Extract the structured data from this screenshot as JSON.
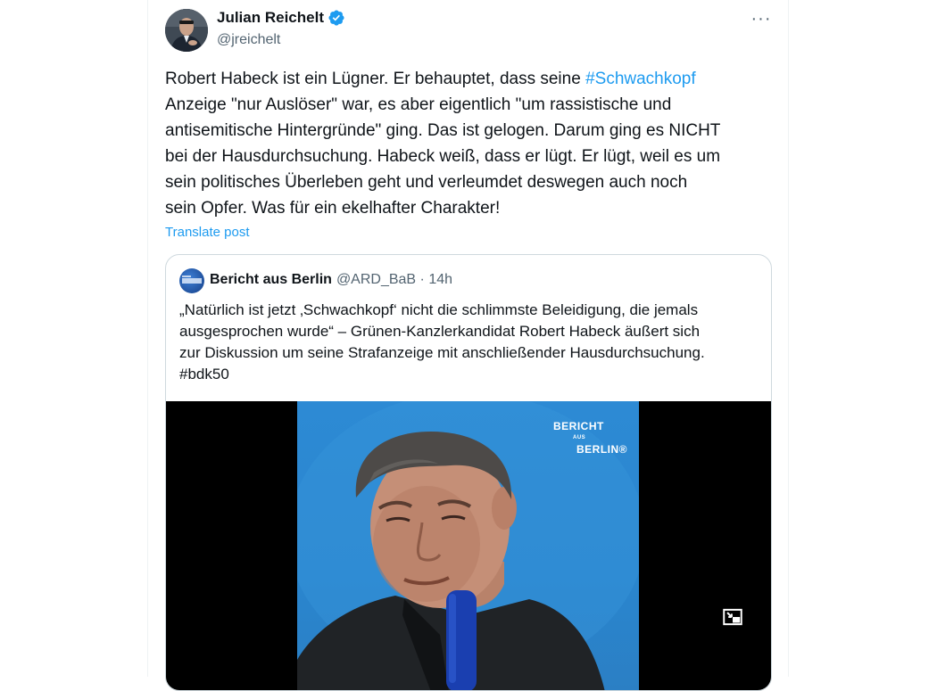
{
  "author": {
    "name": "Julian Reichelt",
    "handle": "@jreichelt"
  },
  "more_label": "···",
  "tweet": {
    "text_before": "Robert Habeck ist ein Lügner. Er behauptet, dass seine ",
    "hashtag": "#Schwachkopf",
    "text_after": "\nAnzeige \"nur Auslöser\" war, es aber eigentlich \"um rassistische und\nantisemitische Hintergründe\" ging. Das ist gelogen. Darum ging es NICHT\nbei der Hausdurchsuchung. Habeck weiß, dass er lügt. Er lügt, weil es um\nsein politisches Überleben geht und verleumdet deswegen auch noch\nsein Opfer. Was für ein ekelhafter Charakter!"
  },
  "translate_label": "Translate post",
  "quote": {
    "name": "Bericht aus Berlin",
    "meta": "@ARD_BaB · 14h",
    "text": "„Natürlich ist jetzt ‚Schwachkopf‘ nicht die schlimmste Beleidigung, die jemals\nausgesprochen wurde“ – Grünen-Kanzlerkandidat Robert Habeck äußert sich\nzur Diskussion um seine Strafanzeige mit anschließender Hausdurchsuchung.\n#bdk50",
    "video_logo_line1": "BERICHT",
    "video_logo_aus": "AUS",
    "video_logo_line2": "BERLIN®"
  },
  "colors": {
    "accent": "#1d9bf0",
    "text": "#0f1419",
    "muted": "#536471",
    "border": "#cfd9de"
  }
}
